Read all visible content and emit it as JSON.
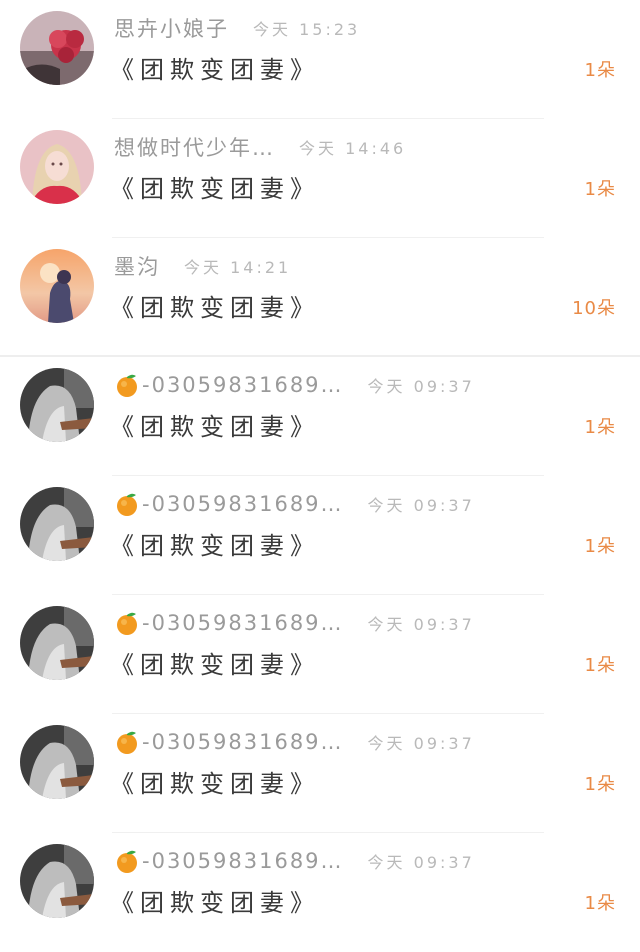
{
  "messages": [
    {
      "name": "思卉小娘子",
      "time": "今天 15:23",
      "title": "《团欺变团妻》",
      "count": "1朵",
      "avatar": "avatar-roses",
      "badge": false
    },
    {
      "name": "想做时代少年…",
      "time": "今天 14:46",
      "title": "《团欺变团妻》",
      "count": "1朵",
      "avatar": "avatar-girl-pink",
      "badge": false
    },
    {
      "name": "墨汮",
      "time": "今天 14:21",
      "title": "《团欺变团妻》",
      "count": "10朵",
      "avatar": "avatar-sunset",
      "badge": false
    },
    {
      "name": "-03059831689…",
      "time": "今天 09:37",
      "title": "《团欺变团妻》",
      "count": "1朵",
      "avatar": "avatar-bw-figure",
      "badge": true
    },
    {
      "name": "-03059831689…",
      "time": "今天 09:37",
      "title": "《团欺变团妻》",
      "count": "1朵",
      "avatar": "avatar-bw-figure",
      "badge": true
    },
    {
      "name": "-03059831689…",
      "time": "今天 09:37",
      "title": "《团欺变团妻》",
      "count": "1朵",
      "avatar": "avatar-bw-figure",
      "badge": true
    },
    {
      "name": "-03059831689…",
      "time": "今天 09:37",
      "title": "《团欺变团妻》",
      "count": "1朵",
      "avatar": "avatar-bw-figure",
      "badge": true
    },
    {
      "name": "-03059831689…",
      "time": "今天 09:37",
      "title": "《团欺变团妻》",
      "count": "1朵",
      "avatar": "avatar-bw-figure",
      "badge": true
    }
  ],
  "colors": {
    "count": "#e98a46",
    "name": "#9a9a9a",
    "title": "#3a3a3a",
    "badge": "orange-icon"
  }
}
